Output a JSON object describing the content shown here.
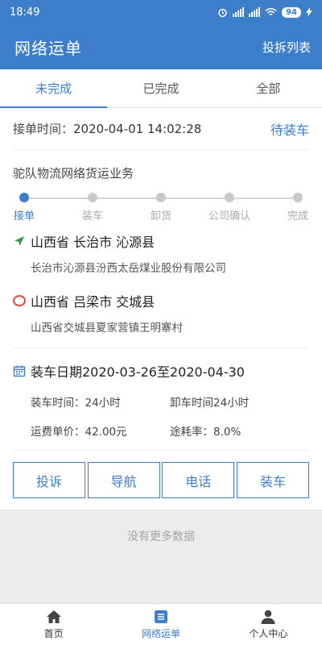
{
  "status_bar": {
    "time": "18:49",
    "battery": "94"
  },
  "header": {
    "title": "网络运单",
    "complaint_list": "投拆列表"
  },
  "tabs": [
    {
      "label": "未完成",
      "active": true
    },
    {
      "label": "已完成",
      "active": false
    },
    {
      "label": "全部",
      "active": false
    }
  ],
  "order": {
    "time_label": "接单时间：",
    "time_value": "2020-04-01 14:02:28",
    "status": "待装车",
    "business": "驼队物流网络货运业务",
    "progress_steps": [
      {
        "label": "接单",
        "done": true
      },
      {
        "label": "装车",
        "done": false
      },
      {
        "label": "卸货",
        "done": false
      },
      {
        "label": "公司确认",
        "done": false
      },
      {
        "label": "完成",
        "done": false
      }
    ],
    "origin": {
      "region": "山西省 长治市 沁源县",
      "detail": "长治市沁源县汾西太岳煤业股份有限公司"
    },
    "destination": {
      "region": "山西省 吕梁市 交城县",
      "detail": "山西省交城县夏家营镇王明寨村"
    },
    "loading_date": "装车日期2020-03-26至2020-04-30",
    "load_time": "装车时间：24小时",
    "unload_time": "卸车时间24小时",
    "unit_price": "运费单价：42.00元",
    "loss_rate": "途耗率：8.0%"
  },
  "actions": {
    "complain": "投诉",
    "navigate": "导航",
    "phone": "电话",
    "load": "装车"
  },
  "footer_text": "没有更多数据",
  "bottom_nav": [
    {
      "label": "首页",
      "icon": "home-icon"
    },
    {
      "label": "网络运单",
      "icon": "waybill-icon"
    },
    {
      "label": "个人中心",
      "icon": "user-icon"
    }
  ],
  "colors": {
    "primary": "#3d7ecb",
    "destination_marker": "#e24b3b",
    "origin_marker": "#2e9a3e"
  }
}
